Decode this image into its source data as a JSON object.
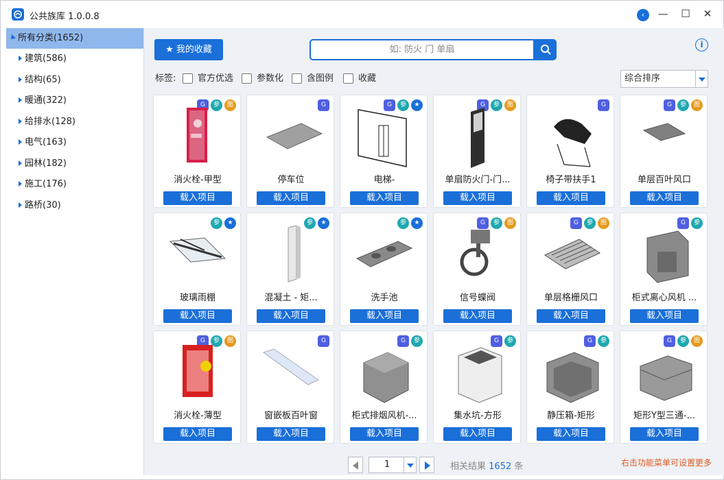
{
  "window": {
    "title": "公共族库 1.0.0.8",
    "back_glyph": "‹",
    "minimize": "—",
    "maximize": "☐",
    "close": "✕"
  },
  "sidebar": {
    "root": "所有分类(1652)",
    "items": [
      {
        "label": "建筑(586)"
      },
      {
        "label": "结构(65)"
      },
      {
        "label": "暖通(322)"
      },
      {
        "label": "给排水(128)"
      },
      {
        "label": "电气(163)"
      },
      {
        "label": "园林(182)"
      },
      {
        "label": "施工(176)"
      },
      {
        "label": "路桥(30)"
      }
    ]
  },
  "toolbar": {
    "favorites_label": "我的收藏",
    "search_placeholder": "如: 防火 门 单扇",
    "info_glyph": "i"
  },
  "filters": {
    "label": "标签:",
    "options": [
      "官方优选",
      "参数化",
      "含图例",
      "收藏"
    ]
  },
  "sort": {
    "selected": "综合排序"
  },
  "badge_glyphs": {
    "param": "参",
    "img": "图",
    "fav": "★",
    "rev": "G"
  },
  "cards": [
    {
      "name": "消火栓-甲型",
      "badges": [
        "rev",
        "param",
        "img"
      ],
      "thumb": "hydrant-red"
    },
    {
      "name": "停车位",
      "badges": [
        "rev"
      ],
      "thumb": "flat-plate"
    },
    {
      "name": "电梯-",
      "badges": [
        "rev",
        "param",
        "fav"
      ],
      "thumb": "elevator"
    },
    {
      "name": "单扇防火门-门...",
      "badges": [
        "rev",
        "param",
        "img"
      ],
      "thumb": "door"
    },
    {
      "name": "椅子带扶手1",
      "badges": [
        "rev"
      ],
      "thumb": "chair"
    },
    {
      "name": "单层百叶风口",
      "badges": [
        "rev",
        "param",
        "img"
      ],
      "thumb": "small-plate"
    },
    {
      "name": "玻璃雨棚",
      "badges": [
        "param",
        "fav"
      ],
      "thumb": "canopy"
    },
    {
      "name": "混凝土 - 矩...",
      "badges": [
        "param",
        "fav"
      ],
      "thumb": "column"
    },
    {
      "name": "洗手池",
      "badges": [
        "param",
        "fav"
      ],
      "thumb": "sink"
    },
    {
      "name": "信号蝶阀",
      "badges": [
        "rev",
        "param",
        "img"
      ],
      "thumb": "valve"
    },
    {
      "name": "单层格栅风口",
      "badges": [
        "rev",
        "param",
        "img"
      ],
      "thumb": "grille"
    },
    {
      "name": "柜式离心风机 ...",
      "badges": [
        "rev",
        "param"
      ],
      "thumb": "cabinet-fan"
    },
    {
      "name": "消火栓-薄型",
      "badges": [
        "rev",
        "param",
        "img"
      ],
      "thumb": "hydrant-thin"
    },
    {
      "name": "窗嵌板百叶窗",
      "badges": [
        "rev"
      ],
      "thumb": "louver"
    },
    {
      "name": "柜式排烟风机-...",
      "badges": [
        "rev",
        "param"
      ],
      "thumb": "box-fan"
    },
    {
      "name": "集水坑-方形",
      "badges": [
        "rev",
        "param"
      ],
      "thumb": "sump"
    },
    {
      "name": "静压箱-矩形",
      "badges": [
        "rev",
        "param"
      ],
      "thumb": "plenum"
    },
    {
      "name": "矩形Y型三通-...",
      "badges": [
        "rev",
        "param",
        "img"
      ],
      "thumb": "tee"
    }
  ],
  "load_label": "载入项目",
  "pager": {
    "page": "1"
  },
  "result": {
    "prefix": "相关结果",
    "count": "1652",
    "suffix": "条"
  },
  "hint": "右击功能菜单可设置更多"
}
